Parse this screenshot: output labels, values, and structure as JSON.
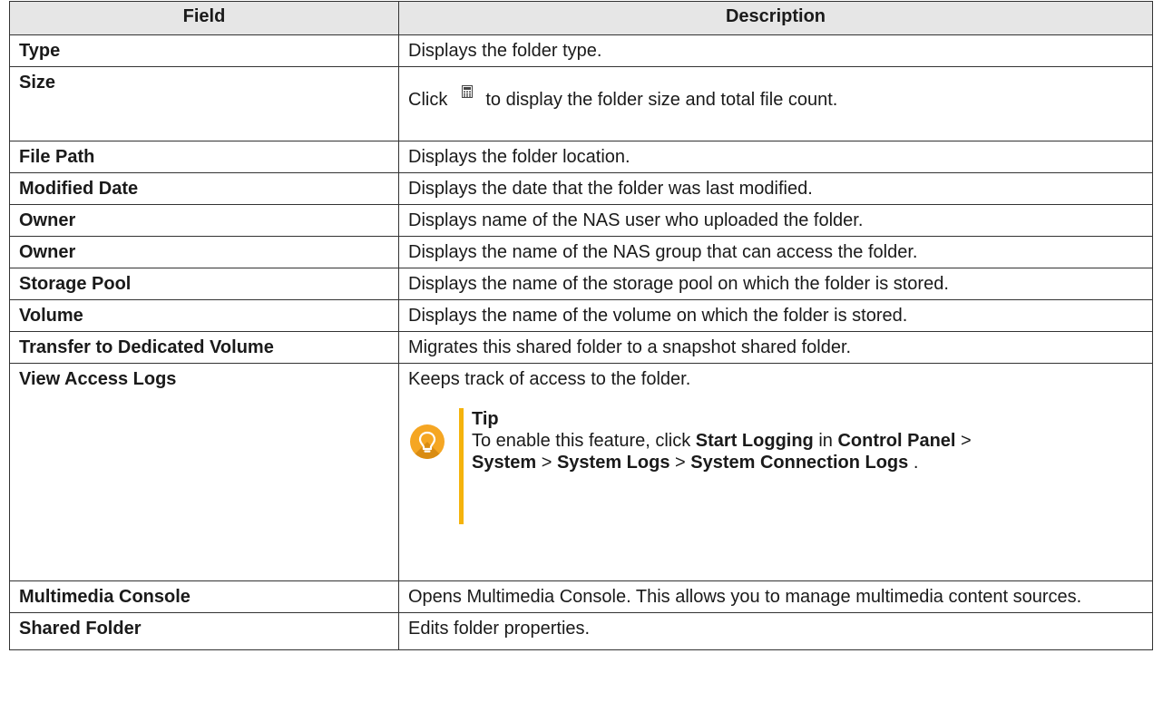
{
  "table": {
    "headers": [
      "Field",
      "Description"
    ],
    "rows": [
      {
        "field": "Type",
        "description": "Displays the folder type."
      },
      {
        "field": "Size",
        "description_prefix": "Click",
        "description_icon": "calculator-icon",
        "description_suffix": "to display the folder size and total file count."
      },
      {
        "field": "File Path",
        "description": "Displays the folder location."
      },
      {
        "field": "Modified Date",
        "description": "Displays the date that the folder was last modified."
      },
      {
        "field": "Owner",
        "description": "Displays name of the NAS user who uploaded the folder."
      },
      {
        "field": "Owner",
        "description": "Displays the name of the NAS group that can access the folder."
      },
      {
        "field": "Storage Pool",
        "description": "Displays the name of the storage pool on which the folder is stored."
      },
      {
        "field": "Volume",
        "description": "Displays the name of the volume on which the folder is stored."
      },
      {
        "field": "Transfer to Dedicated Volume",
        "description": "Migrates this shared folder to a snapshot shared folder."
      },
      {
        "field": "View Access Logs",
        "description": "Keeps track of access to the folder.",
        "tip": {
          "title": "Tip",
          "icon": "lightbulb-icon",
          "parts": [
            "To enable this feature, click ",
            "Start Logging",
            " in ",
            "Control Panel",
            " > ",
            "System",
            " > ",
            "System Logs",
            " > ",
            "System Connection Logs",
            " ."
          ]
        }
      },
      {
        "field": "Multimedia Console",
        "description": "Opens Multimedia Console. This allows you to manage multimedia content sources."
      },
      {
        "field": "Shared Folder",
        "description": "Edits folder properties."
      }
    ]
  },
  "colors": {
    "header_bg": "#e6e6e6",
    "border": "#333333",
    "tip_accent": "#f5b30c",
    "tip_icon": "#f5a623"
  }
}
